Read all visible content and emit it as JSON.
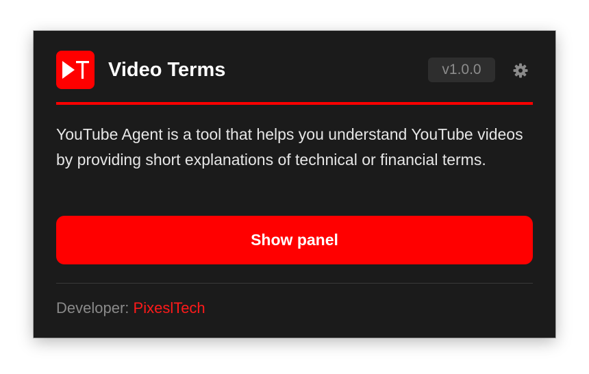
{
  "header": {
    "logo_icon": "play-t-logo-icon",
    "title": "Video Terms",
    "version": "v1.0.0",
    "settings_icon": "gear-icon"
  },
  "main": {
    "description": "YouTube Agent is a tool that helps you understand YouTube videos by providing short explanations of technical or financial terms.",
    "show_panel_label": "Show panel"
  },
  "footer": {
    "developer_label": "Developer:",
    "developer_name": "PixeslTech"
  },
  "colors": {
    "accent": "#ff0000",
    "background": "#1b1b1b",
    "version_badge": "#2e2e2e"
  }
}
